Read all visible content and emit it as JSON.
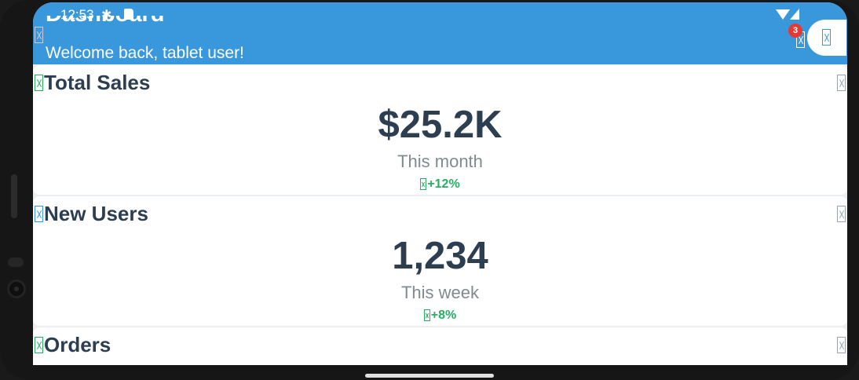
{
  "status_bar": {
    "time": "12:53"
  },
  "header": {
    "title": "Dashboard",
    "subtitle": "Welcome back, tablet user!",
    "notification_count": "3",
    "accent_color": "#3998db"
  },
  "cards": [
    {
      "title": "Total Sales",
      "value": "$25.2K",
      "period": "This month",
      "change": "+12%",
      "icon_color": "#27ae60"
    },
    {
      "title": "New Users",
      "value": "1,234",
      "period": "This week",
      "change": "+8%",
      "icon_color": "#3998db"
    },
    {
      "title": "Orders",
      "icon_color": "#27ae60"
    }
  ],
  "colors": {
    "positive": "#27ae60",
    "text_dark": "#2c3e50",
    "badge": "#e53935"
  }
}
